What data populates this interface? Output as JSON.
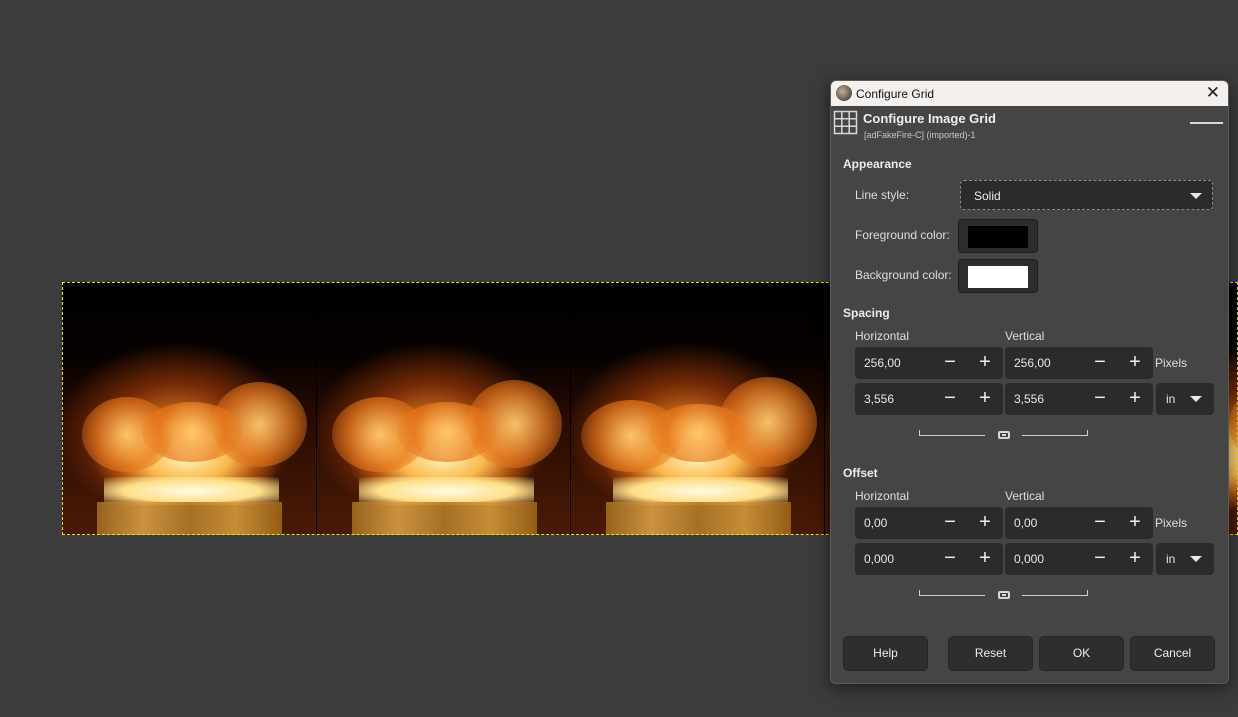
{
  "dialog": {
    "window_title": "Configure Grid",
    "title": "Configure Image Grid",
    "subtitle": "[adFakeFire-C] (imported)-1",
    "close_glyph": "✕"
  },
  "appearance": {
    "heading": "Appearance",
    "line_style_label": "Line style:",
    "line_style_value": "Solid",
    "foreground_label": "Foreground color:",
    "foreground_color": "#000000",
    "background_label": "Background color:",
    "background_color": "#ffffff"
  },
  "spacing": {
    "heading": "Spacing",
    "horizontal_label": "Horizontal",
    "vertical_label": "Vertical",
    "h_pixels": "256,00",
    "v_pixels": "256,00",
    "pixels_unit": "Pixels",
    "h_inches": "3,556",
    "v_inches": "3,556",
    "unit": "in"
  },
  "offset": {
    "heading": "Offset",
    "horizontal_label": "Horizontal",
    "vertical_label": "Vertical",
    "h_pixels": "0,00",
    "v_pixels": "0,00",
    "pixels_unit": "Pixels",
    "h_inches": "0,000",
    "v_inches": "0,000",
    "unit": "in"
  },
  "spin_glyphs": {
    "minus": "−",
    "plus": "+"
  },
  "buttons": {
    "help": "Help",
    "reset": "Reset",
    "ok": "OK",
    "cancel": "Cancel"
  },
  "icons": {
    "app": "gimp-icon",
    "header": "grid-icon",
    "close": "close-icon",
    "dropdown": "caret-down-icon",
    "chain": "chain-link-icon"
  },
  "colors": {
    "workspace": "#3c3c3c",
    "dialog_bg": "#454545",
    "field_bg": "#2b2b2b",
    "selection": "#e8e800"
  }
}
